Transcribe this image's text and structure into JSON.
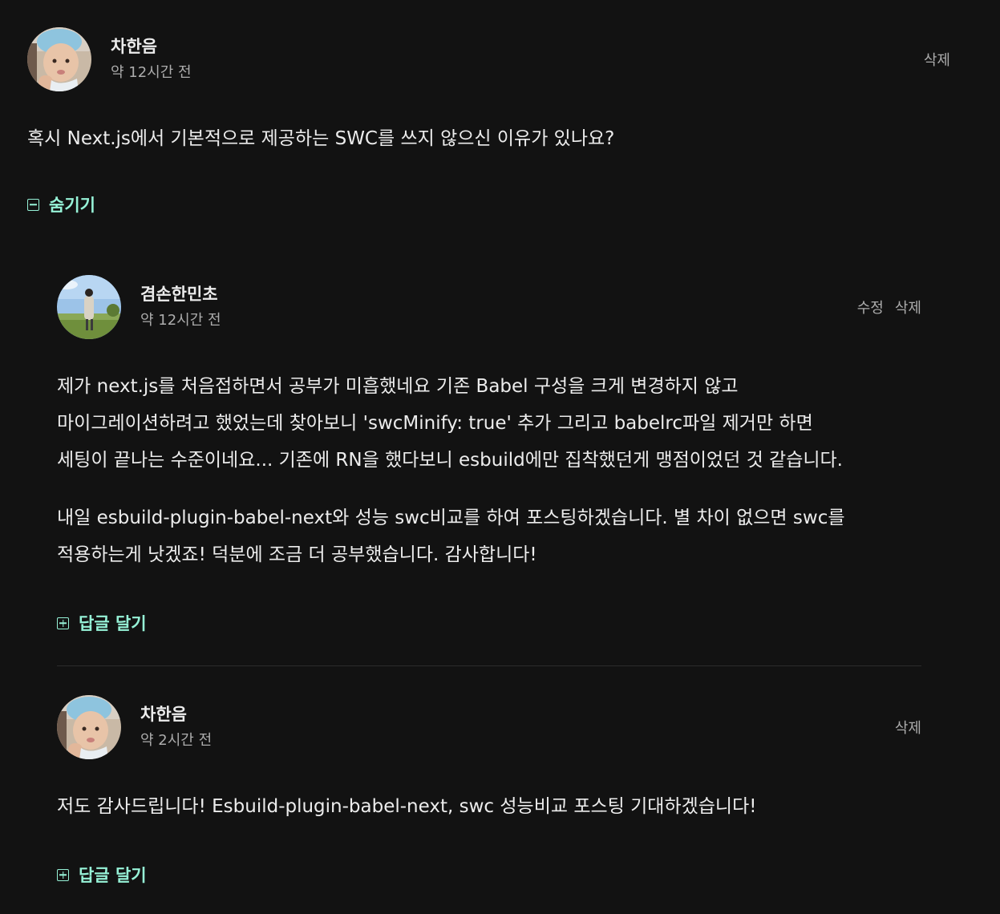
{
  "root_comment": {
    "author": "차한음",
    "time": "약 12시간 전",
    "delete_label": "삭제",
    "text": "혹시 Next.js에서 기본적으로 제공하는 SWC를 쓰지 않으신 이유가 있나요?",
    "toggle_label": "숨기기"
  },
  "replies": [
    {
      "author": "겸손한민초",
      "time": "약 12시간 전",
      "edit_label": "수정",
      "delete_label": "삭제",
      "lines_p1": [
        "제가 next.js를 처음접하면서 공부가 미흡했네요 기존 Babel 구성을 크게 변경하지 않고",
        "마이그레이션하려고 했었는데 찾아보니 'swcMinify: true' 추가 그리고 babelrc파일 제거만 하면",
        "세팅이 끝나는 수준이네요... 기존에 RN을 했다보니 esbuild에만 집착했던게 맹점이었던 것 같습니다."
      ],
      "lines_p2": [
        "내일 esbuild-plugin-babel-next와 성능 swc비교를 하여 포스팅하겠습니다. 별 차이 없으면 swc를",
        "적용하는게 낫겠죠! 덕분에 조금 더 공부했습니다. 감사합니다!"
      ],
      "reply_label": "답글 달기"
    },
    {
      "author": "차한음",
      "time": "약 2시간 전",
      "delete_label": "삭제",
      "text": "저도 감사드립니다! Esbuild-plugin-babel-next, swc 성능비교 포스팅 기대하겠습니다!",
      "reply_label": "답글 달기"
    }
  ],
  "colors": {
    "background": "#121212",
    "text": "#ececec",
    "muted": "#acacac",
    "accent": "#96f2d7",
    "divider": "#2c2c2c"
  },
  "icons": {
    "collapse": "minus-square-icon",
    "expand": "plus-square-icon"
  }
}
